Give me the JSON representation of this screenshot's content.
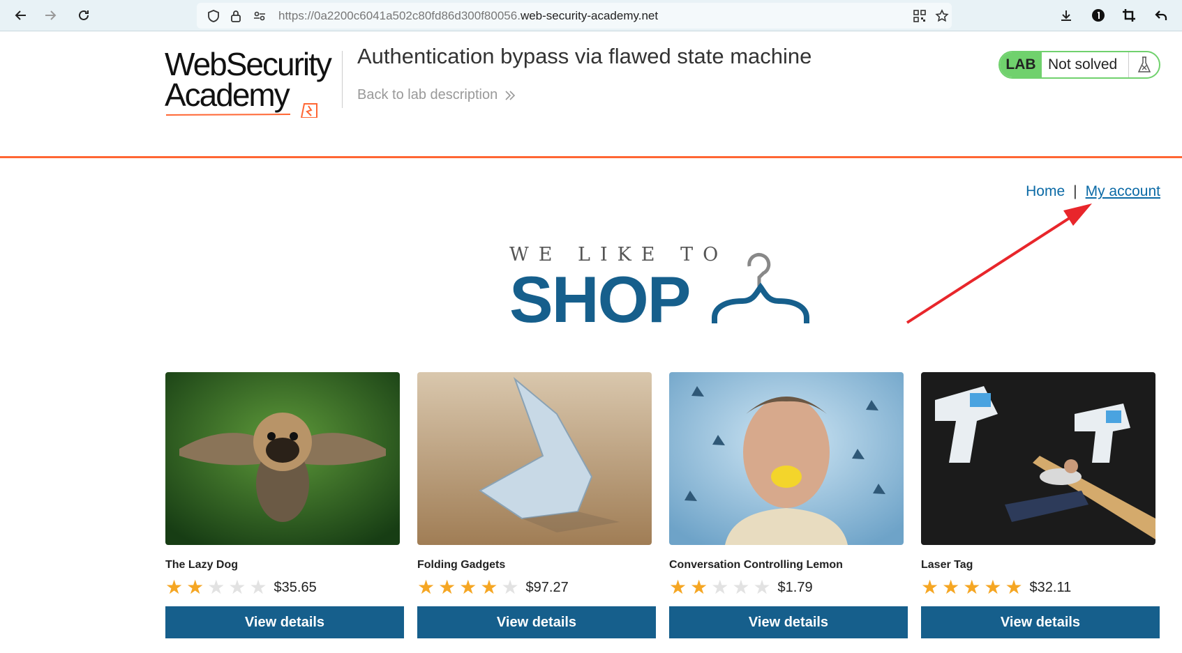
{
  "browser": {
    "url_prefix": "https://0a2200c6041a502c80fd86d300f80056.",
    "url_host": "web-security-academy.net"
  },
  "header": {
    "logo_line1": "WebSecurity",
    "logo_line2": "Academy",
    "lab_title": "Authentication bypass via flawed state machine",
    "back_link": "Back to lab description",
    "lab_badge": "LAB",
    "lab_status": "Not solved"
  },
  "nav": {
    "home": "Home",
    "separator": "|",
    "my_account": "My account"
  },
  "banner": {
    "line1": "WE LIKE TO",
    "line2": "SHOP"
  },
  "products": [
    {
      "name": "The Lazy Dog",
      "rating": 2,
      "price": "$35.65",
      "button": "View details"
    },
    {
      "name": "Folding Gadgets",
      "rating": 4,
      "price": "$97.27",
      "button": "View details"
    },
    {
      "name": "Conversation Controlling Lemon",
      "rating": 2,
      "price": "$1.79",
      "button": "View details"
    },
    {
      "name": "Laser Tag",
      "rating": 5,
      "price": "$32.11",
      "button": "View details"
    }
  ],
  "rating_max": 5,
  "colors": {
    "accent": "#ff6633",
    "brand_blue": "#165f8c",
    "link_blue": "#0b6aa6",
    "lab_green": "#70d16d",
    "star": "#f5a623",
    "annotation_arrow": "#e8262b"
  }
}
